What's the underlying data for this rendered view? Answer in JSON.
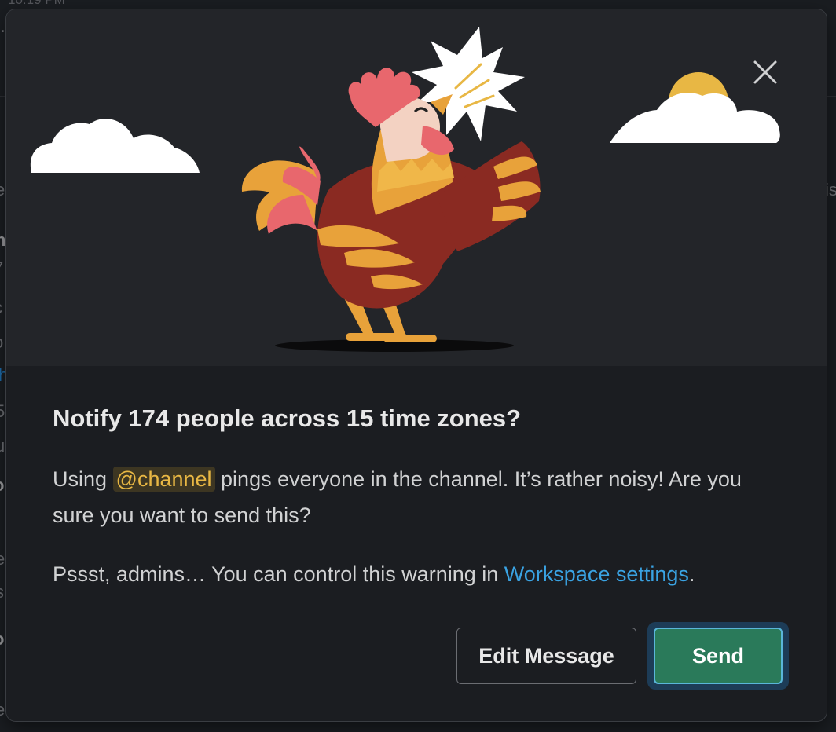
{
  "background": {
    "time_fragment": "10:19 PM"
  },
  "modal": {
    "close_icon": "close-icon",
    "title": "Notify 174 people across 15 time zones?",
    "paragraph1": {
      "before": "Using ",
      "mention": "@channel",
      "after": " pings everyone in the channel. It’s rather noisy! Are you sure you want to send this?"
    },
    "paragraph2": {
      "before": "Pssst, admins… You can control this warning in ",
      "link": "Workspace settings",
      "after": "."
    },
    "buttons": {
      "edit_label": "Edit Message",
      "send_label": "Send"
    },
    "colors": {
      "mention_text": "#e8b744",
      "link": "#3aa3e3",
      "send_bg": "#2a7a5a",
      "send_focus_ring": "#5ab6d9"
    }
  }
}
